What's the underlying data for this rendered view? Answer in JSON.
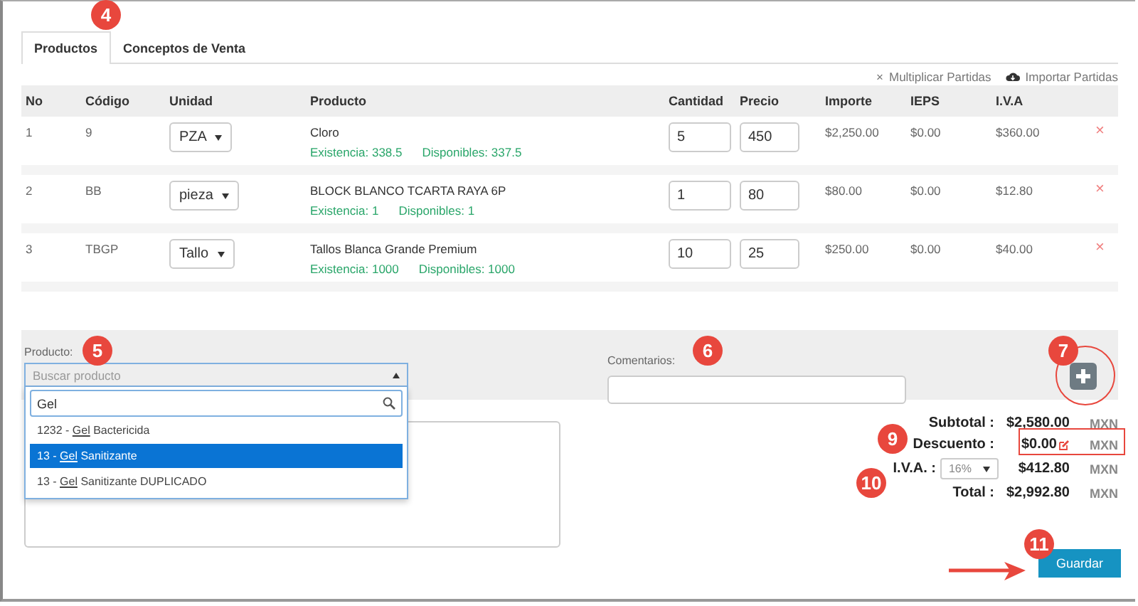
{
  "tabs": [
    {
      "label": "Productos",
      "selected": true
    },
    {
      "label": "Conceptos de Venta",
      "selected": false
    }
  ],
  "toolbar": {
    "multiply_icon": "×",
    "multiply": "Multiplicar Partidas",
    "import": "Importar Partidas"
  },
  "table": {
    "columns": [
      "No",
      "Código",
      "Unidad",
      "Producto",
      "Cantidad",
      "Precio",
      "Importe",
      "IEPS",
      "I.V.A"
    ],
    "rows": [
      {
        "no": "1",
        "code": "9",
        "unit": "PZA",
        "product": "Cloro",
        "stock": "Existencia: 338.5",
        "available": "Disponibles: 337.5",
        "qty": "5",
        "price": "450",
        "amount": "$2,250.00",
        "ieps": "$0.00",
        "iva": "$360.00",
        "delete": "×"
      },
      {
        "no": "2",
        "code": "BB",
        "unit": "pieza",
        "product": "BLOCK BLANCO TCARTA RAYA 6P",
        "stock": "Existencia: 1",
        "available": "Disponibles: 1",
        "qty": "1",
        "price": "80",
        "amount": "$80.00",
        "ieps": "$0.00",
        "iva": "$12.80",
        "delete": "×"
      },
      {
        "no": "3",
        "code": "TBGP",
        "unit": "Tallo",
        "product": "Tallos Blanca Grande Premium",
        "stock": "Existencia: 1000",
        "available": "Disponibles: 1000",
        "qty": "10",
        "price": "25",
        "amount": "$250.00",
        "ieps": "$0.00",
        "iva": "$40.00",
        "delete": "×"
      }
    ]
  },
  "product_picker": {
    "label": "Producto:",
    "placeholder": "Buscar producto",
    "search_value": "Gel",
    "expanded": true,
    "options": [
      {
        "prefix": "1232 - ",
        "match": "Gel",
        "rest": " Bactericida",
        "selected": false
      },
      {
        "prefix": "13 - ",
        "match": "Gel",
        "rest": " Sanitizante",
        "selected": true
      },
      {
        "prefix": "13 - ",
        "match": "Gel",
        "rest": " Sanitizante DUPLICADO",
        "selected": false
      }
    ]
  },
  "comments": {
    "label": "Comentarios:"
  },
  "totals": {
    "subtotal_label": "Subtotal :",
    "subtotal": "$2,580.00",
    "discount_label": "Descuento :",
    "discount": "$0.00",
    "iva_label": "I.V.A. :",
    "iva_rate": "16%",
    "iva": "$412.80",
    "total_label": "Total :",
    "total": "$2,992.80",
    "currencies": [
      "MXN",
      "MXN",
      "MXN",
      "MXN"
    ]
  },
  "save_button": "Guardar",
  "annotations": [
    "4",
    "5",
    "6",
    "7",
    "9",
    "10",
    "11"
  ]
}
